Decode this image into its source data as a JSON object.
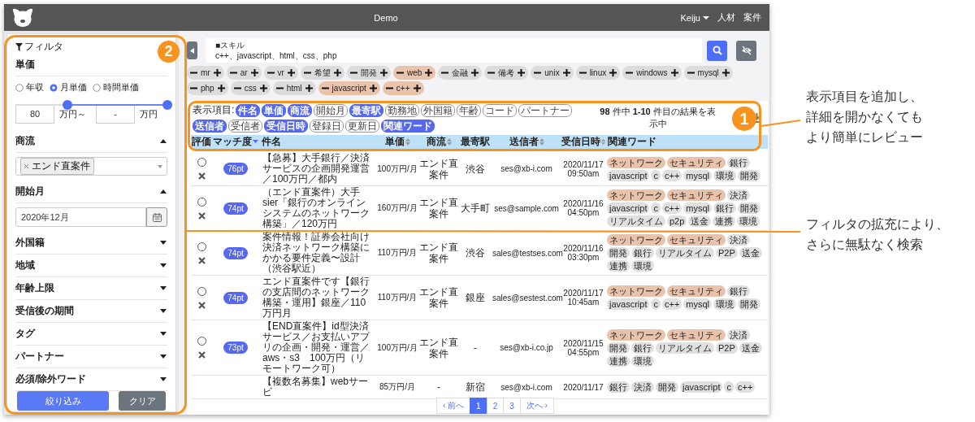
{
  "header": {
    "title": "Demo",
    "user": "Keiju",
    "nav": [
      {
        "label": "人材"
      },
      {
        "label": "案件"
      }
    ]
  },
  "filter": {
    "title": "フィルタ",
    "price": {
      "label": "単価",
      "modes": [
        {
          "label": "年収",
          "selected": false
        },
        {
          "label": "月単価",
          "selected": true
        },
        {
          "label": "時間単価",
          "selected": false
        }
      ],
      "range": [
        {
          "level": 0.34
        },
        {
          "level": 1
        }
      ],
      "min": {
        "value": "80",
        "unit": "万円～"
      },
      "max": {
        "value": "-",
        "unit": "万円"
      }
    },
    "sections": [
      {
        "label": "商流",
        "expanded": true,
        "kind": "tags",
        "tags": [
          "エンド直案件"
        ]
      },
      {
        "label": "開始月",
        "expanded": true,
        "kind": "date",
        "value": "2020年12月"
      },
      {
        "label": "外国籍",
        "expanded": false
      },
      {
        "label": "地域",
        "expanded": false
      },
      {
        "label": "年齢上限",
        "expanded": false
      },
      {
        "label": "受信後の期間",
        "expanded": false
      },
      {
        "label": "タグ",
        "expanded": false
      },
      {
        "label": "パートナー",
        "expanded": false
      },
      {
        "label": "必須/除外ワード",
        "expanded": false
      }
    ],
    "buttons": [
      {
        "label": "絞り込み",
        "kind": "primary"
      },
      {
        "label": "クリア",
        "kind": "secondary"
      }
    ]
  },
  "search": {
    "lines": [
      "■スキル",
      "c++、javascript、html、css、php"
    ]
  },
  "skills": [
    {
      "label": "mr",
      "highlighted": false
    },
    {
      "label": "ar",
      "highlighted": false
    },
    {
      "label": "vr",
      "highlighted": false
    },
    {
      "label": "希望",
      "highlighted": false
    },
    {
      "label": "開発",
      "highlighted": false
    },
    {
      "label": "web",
      "highlighted": true
    },
    {
      "label": "金融",
      "highlighted": false
    },
    {
      "label": "備考",
      "highlighted": false
    },
    {
      "label": "unix",
      "highlighted": false
    },
    {
      "label": "linux",
      "highlighted": false
    },
    {
      "label": "windows",
      "highlighted": false
    },
    {
      "label": "mysql",
      "highlighted": false
    },
    {
      "label": "php",
      "highlighted": false
    },
    {
      "label": "css",
      "highlighted": false
    },
    {
      "label": "html",
      "highlighted": false
    },
    {
      "label": "javascript",
      "highlighted": true
    },
    {
      "label": "c++",
      "highlighted": true
    }
  ],
  "columns_picker": {
    "label": "表示項目:",
    "items": [
      {
        "label": "件名",
        "selected": true
      },
      {
        "label": "単価",
        "selected": true
      },
      {
        "label": "商流",
        "selected": true
      },
      {
        "label": "開始月",
        "selected": false
      },
      {
        "label": "最寄駅",
        "selected": true
      },
      {
        "label": "勤務地",
        "selected": false
      },
      {
        "label": "外国籍",
        "selected": false
      },
      {
        "label": "年齢",
        "selected": false
      },
      {
        "label": "コード",
        "selected": false
      },
      {
        "label": "パートナー",
        "selected": false
      },
      {
        "label": "送信者",
        "selected": true
      },
      {
        "label": "受信者",
        "selected": false
      },
      {
        "label": "受信日時",
        "selected": true
      },
      {
        "label": "登録日",
        "selected": false
      },
      {
        "label": "更新日",
        "selected": false
      },
      {
        "label": "関連ワード",
        "selected": true
      }
    ]
  },
  "results_summary": "**98** 件中 **1-10** 件目の結果を表示中",
  "table": {
    "columns": [
      {
        "label": "評価"
      },
      {
        "label": "マッチ度",
        "sorted": true
      },
      {
        "label": "件名"
      },
      {
        "label": "単価",
        "sorted": false
      },
      {
        "label": "商流",
        "sorted": false
      },
      {
        "label": "最寄駅"
      },
      {
        "label": "送信者",
        "sorted": false
      },
      {
        "label": "受信日時",
        "sorted": false
      },
      {
        "label": "関連ワード"
      }
    ],
    "rows": [
      {
        "selected": false,
        "score": "76pt",
        "title": "【急募】大手銀行／決済サービスの企画開発運営／100万円／都内",
        "price": "100万円/月",
        "flow": "エンド直案件",
        "station": "渋谷",
        "sender": "ses@xb-i.com",
        "date": "2020/11/17",
        "time": "09:50am",
        "tags": [
          {
            "label": "ネットワーク",
            "highlighted": true
          },
          {
            "label": "セキュリティ",
            "highlighted": true
          },
          {
            "label": "銀行",
            "highlighted": false
          },
          {
            "label": "javascript",
            "highlighted": false
          },
          {
            "label": "c",
            "highlighted": false
          },
          {
            "label": "c++",
            "highlighted": false
          },
          {
            "label": "mysql",
            "highlighted": false
          },
          {
            "label": "環境",
            "highlighted": false
          },
          {
            "label": "開発",
            "highlighted": false
          }
        ]
      },
      {
        "selected": false,
        "score": "74pt",
        "title": "（エンド直案件）大手sier「銀行のオンラインシステムのネットワーク構築」／120万円",
        "price": "160万円/月",
        "flow": "エンド直案件",
        "station": "大手町",
        "sender": "ses@sample.com",
        "date": "2020/11/16",
        "time": "04:50pm",
        "tags": [
          {
            "label": "ネットワーク",
            "highlighted": true
          },
          {
            "label": "セキュリティ",
            "highlighted": true
          },
          {
            "label": "決済",
            "highlighted": false
          },
          {
            "label": "javascript",
            "highlighted": false
          },
          {
            "label": "c",
            "highlighted": false
          },
          {
            "label": "c++",
            "highlighted": false
          },
          {
            "label": "mysql",
            "highlighted": false
          },
          {
            "label": "銀行",
            "highlighted": false
          },
          {
            "label": "開発",
            "highlighted": false
          },
          {
            "label": "リアルタイム",
            "highlighted": false
          },
          {
            "label": "p2p",
            "highlighted": false
          },
          {
            "label": "送金",
            "highlighted": false
          },
          {
            "label": "連携",
            "highlighted": false
          },
          {
            "label": "環境",
            "highlighted": false
          }
        ]
      },
      {
        "selected": false,
        "score": "74pt",
        "title": "案件情報！証券会社向け決済ネットワーク構築にかかる要件定義〜設計（渋谷駅近）",
        "price": "110万円/月",
        "flow": "エンド直案件",
        "station": "渋谷",
        "sender": "sales@testses.com",
        "date": "2020/11/16",
        "time": "03:30pm",
        "tags": [
          {
            "label": "ネットワーク",
            "highlighted": true
          },
          {
            "label": "セキュリティ",
            "highlighted": true
          },
          {
            "label": "決済",
            "highlighted": false
          },
          {
            "label": "開発",
            "highlighted": false
          },
          {
            "label": "銀行",
            "highlighted": false
          },
          {
            "label": "リアルタイム",
            "highlighted": false
          },
          {
            "label": "P2P",
            "highlighted": false
          },
          {
            "label": "送金",
            "highlighted": false
          },
          {
            "label": "連携",
            "highlighted": false
          },
          {
            "label": "環境",
            "highlighted": false
          }
        ]
      },
      {
        "selected": false,
        "score": "74pt",
        "title": "エンド直案件です【銀行の支店間のネットワーク構築・運用】銀座／110万円月",
        "price": "110万円/月",
        "flow": "エンド直案件",
        "station": "銀座",
        "sender": "sales@sestest.com",
        "date": "2020/11/17",
        "time": "10:45am",
        "tags": [
          {
            "label": "ネットワーク",
            "highlighted": true
          },
          {
            "label": "セキュリティ",
            "highlighted": true
          },
          {
            "label": "銀行",
            "highlighted": false
          },
          {
            "label": "javascript",
            "highlighted": false
          },
          {
            "label": "c",
            "highlighted": false
          },
          {
            "label": "c++",
            "highlighted": false
          },
          {
            "label": "mysql",
            "highlighted": false
          },
          {
            "label": "環境",
            "highlighted": false
          },
          {
            "label": "開発",
            "highlighted": false
          }
        ]
      },
      {
        "selected": false,
        "score": "73pt",
        "title": "【END直案件】id型決済サービス／お支払いアプリの企画・開発・運営／aws・s3　100万円（リモートワーク可）",
        "price": "100万円/月",
        "flow": "エンド直案件",
        "station": "-",
        "sender": "ses@xb-i.co.jp",
        "date": "2020/11/15",
        "time": "04:55pm",
        "tags": [
          {
            "label": "ネットワーク",
            "highlighted": true
          },
          {
            "label": "セキュリティ",
            "highlighted": true
          },
          {
            "label": "決済",
            "highlighted": false
          },
          {
            "label": "開発",
            "highlighted": false
          },
          {
            "label": "銀行",
            "highlighted": false
          },
          {
            "label": "リアルタイム",
            "highlighted": false
          },
          {
            "label": "P2P",
            "highlighted": false
          },
          {
            "label": "送金",
            "highlighted": false
          },
          {
            "label": "連携",
            "highlighted": false
          },
          {
            "label": "環境",
            "highlighted": false
          }
        ]
      },
      {
        "title": "【複数名募集】webサービ",
        "price": "85万円/月",
        "flow": "-",
        "station": "新宿",
        "sender": "ses@xb-i.com",
        "date": "2020/11/17",
        "tags": [
          {
            "label": "銀行",
            "highlighted": false
          },
          {
            "label": "決済",
            "highlighted": false
          },
          {
            "label": "開発",
            "highlighted": false
          },
          {
            "label": "javascript",
            "highlighted": false
          },
          {
            "label": "c",
            "highlighted": false
          },
          {
            "label": "c++",
            "highlighted": false
          }
        ]
      }
    ]
  },
  "pagination": {
    "prev": "‹ 前へ",
    "pages": [
      {
        "label": "1",
        "selected": true
      },
      {
        "label": "2",
        "selected": false
      },
      {
        "label": "3",
        "selected": false
      }
    ],
    "next": "次へ ›"
  },
  "annotations": [
    {
      "number": "1",
      "lines": [
        "表示項目を追加し、",
        "詳細を開かなくても",
        "より簡単にレビュー"
      ]
    },
    {
      "number": "2",
      "lines": [
        "フィルタの拡充により、",
        "さらに無駄なく検索"
      ]
    }
  ]
}
